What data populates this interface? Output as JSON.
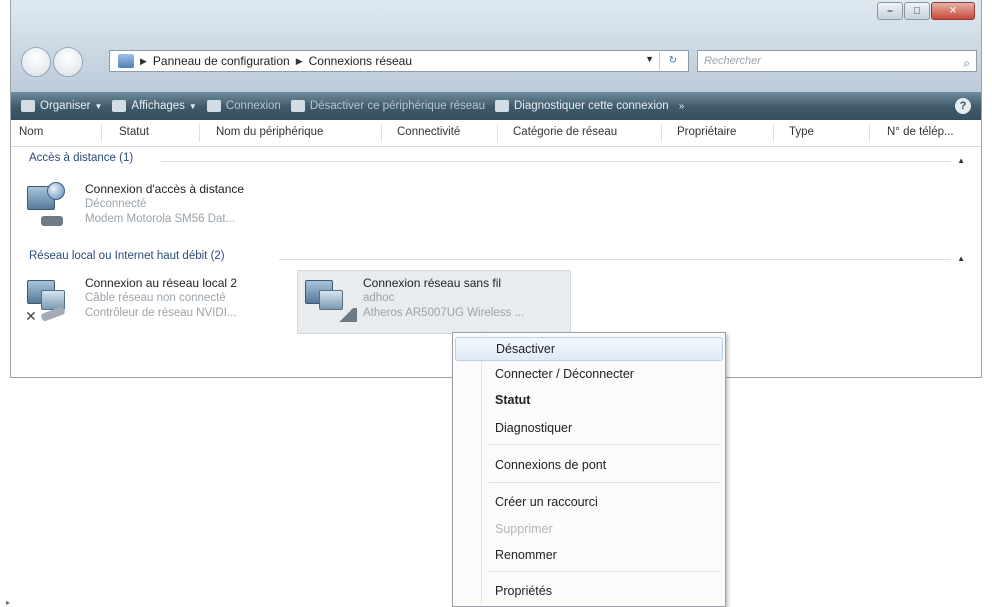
{
  "window": {
    "address": {
      "root": "Panneau de configuration",
      "current": "Connexions réseau"
    },
    "search_placeholder": "Rechercher"
  },
  "toolbar": {
    "organize": "Organiser",
    "views": "Affichages",
    "connect": "Connexion",
    "disable_device": "Désactiver ce périphérique réseau",
    "diagnose": "Diagnostiquer cette connexion"
  },
  "columns": [
    "Nom",
    "Statut",
    "Nom du périphérique",
    "Connectivité",
    "Catégorie de réseau",
    "Propriétaire",
    "Type",
    "N° de télép..."
  ],
  "groups": [
    {
      "title": "Accès à distance (1)",
      "items": [
        {
          "name": "Connexion d'accès à distance",
          "status": "Déconnecté",
          "device": "Modem Motorola SM56 Dat..."
        }
      ]
    },
    {
      "title": "Réseau local ou Internet haut débit (2)",
      "items": [
        {
          "name": "Connexion au réseau local 2",
          "status": "Câble réseau non connecté",
          "device": "Contrôleur de réseau NVIDI..."
        },
        {
          "name": "Connexion réseau sans fil",
          "status": "adhoc",
          "device": "Atheros AR5007UG Wireless ..."
        }
      ]
    }
  ],
  "context_menu": {
    "items": [
      {
        "label": "Désactiver",
        "state": "highlighted"
      },
      {
        "label": "Connecter / Déconnecter",
        "state": "normal"
      },
      {
        "label": "Statut",
        "state": "bold"
      },
      {
        "label": "Diagnostiquer",
        "state": "normal"
      },
      {
        "label": "Connexions de pont",
        "state": "normal"
      },
      {
        "label": "Créer un raccourci",
        "state": "normal"
      },
      {
        "label": "Supprimer",
        "state": "disabled"
      },
      {
        "label": "Renommer",
        "state": "normal"
      },
      {
        "label": "Propriétés",
        "state": "normal"
      }
    ]
  },
  "colors": {
    "toolbar": "#3f5969",
    "group_title": "#2b4b7a",
    "menu_highlight": "#dfeaf6"
  }
}
